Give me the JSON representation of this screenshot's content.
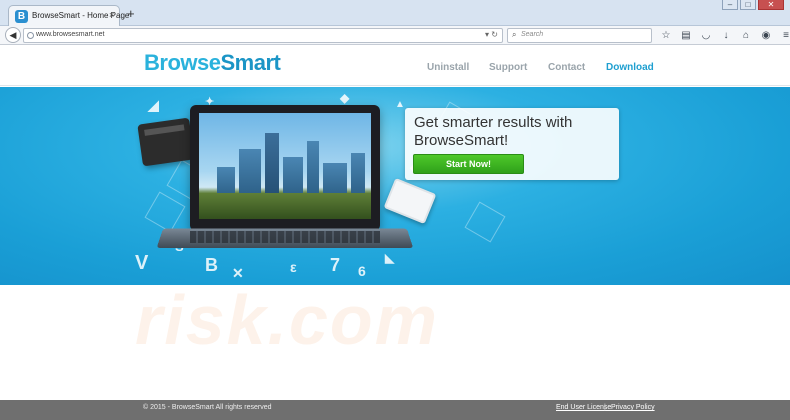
{
  "browser": {
    "tab_title": "BrowseSmart - Home Page",
    "tab_logo": "B",
    "tab_close": "×",
    "new_tab": "+",
    "url": "www.browsesmart.net",
    "search_placeholder": "Search",
    "icons": [
      "star-icon",
      "clipboard-icon",
      "pocket-icon",
      "download-icon",
      "home-icon",
      "chat-icon",
      "menu-icon"
    ]
  },
  "site": {
    "logo_part1": "Browse",
    "logo_part2": "Smart",
    "nav": {
      "uninstall": "Uninstall",
      "support": "Support",
      "contact": "Contact",
      "download": "Download"
    },
    "hero": {
      "headline": "Get smarter results with BrowseSmart!",
      "cta": "Start Now!"
    },
    "footer": {
      "copyright": "© 2015 - BrowseSmart All rights reserved",
      "eula": "End User License",
      "separator": "|",
      "privacy": "Privacy Policy"
    }
  },
  "colors": {
    "brand_light": "#2ab2dc",
    "brand_dark": "#1b95c6",
    "hero_bg": "#1a9fd6",
    "cta_green": "#3cb521",
    "footer_bg": "#6f6f6f"
  }
}
